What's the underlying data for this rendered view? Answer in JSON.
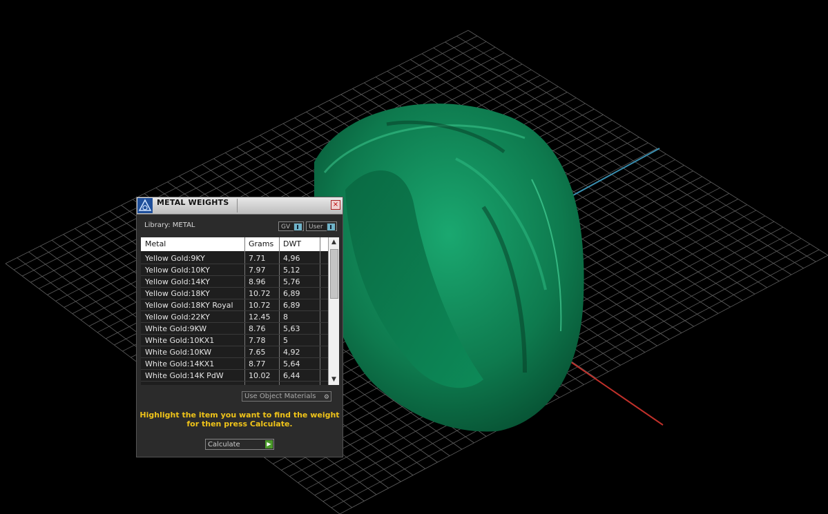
{
  "panel": {
    "title": "METAL WEIGHTS",
    "close": "×",
    "library_label": "Library: METAL",
    "toggles": {
      "gv": "GV",
      "user": "User"
    },
    "columns": [
      "Metal",
      "Grams",
      "DWT"
    ],
    "rows": [
      [
        "Yellow Gold:9KY",
        "7.71",
        "4,96"
      ],
      [
        "Yellow Gold:10KY",
        "7.97",
        "5,12"
      ],
      [
        "Yellow Gold:14KY",
        "8.96",
        "5,76"
      ],
      [
        "Yellow Gold:18KY",
        "10.72",
        "6,89"
      ],
      [
        "Yellow Gold:18KY Royal",
        "10.72",
        "6,89"
      ],
      [
        "Yellow Gold:22KY",
        "12.45",
        "8"
      ],
      [
        "White Gold:9KW",
        "8.76",
        "5,63"
      ],
      [
        "White Gold:10KX1",
        "7.78",
        "5"
      ],
      [
        "White Gold:10KW",
        "7.65",
        "4,92"
      ],
      [
        "White Gold:14KX1",
        "8.77",
        "5,64"
      ],
      [
        "White Gold:14K PdW",
        "10.02",
        "6,44"
      ]
    ],
    "use_object_materials": "Use Object Materials",
    "hint_line1": "Highlight the item you want to find the weight",
    "hint_line2": "for then press Calculate.",
    "calculate_label": "Calculate"
  },
  "icons": {
    "close": "close-icon",
    "scroll_up": "chevron-up-icon",
    "scroll_down": "chevron-down-icon",
    "calculate": "play-arrow-icon",
    "gear": "gear-icon",
    "logo": "app-logo-icon"
  },
  "colors": {
    "ring": "#0f7a4e",
    "grid": "#8a8a8a",
    "axis_x": "#c0302a",
    "axis_y": "#3a8fb0",
    "hint_text": "#f0c419",
    "panel_bg": "#2b2b2b"
  }
}
